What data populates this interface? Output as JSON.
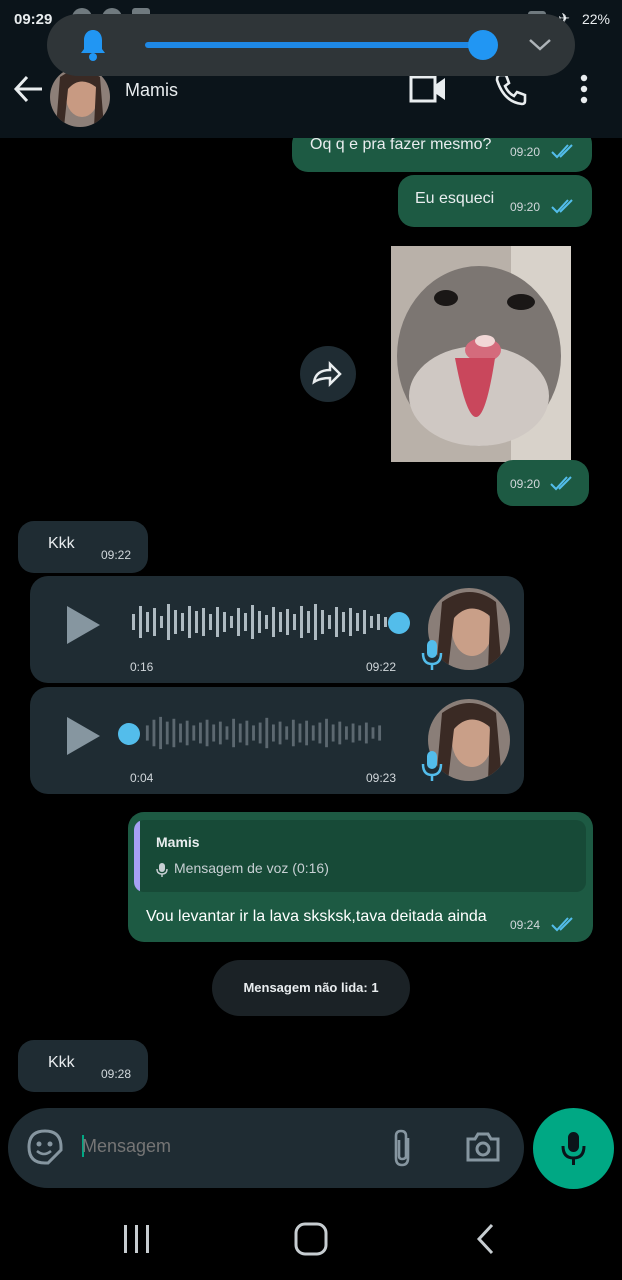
{
  "status": {
    "time": "09:29",
    "battery": "22%"
  },
  "volume": {
    "level": 1.0
  },
  "header": {
    "contact_name": "Mamis"
  },
  "messages": [
    {
      "dir": "out",
      "text": "Oq q e pra fazer mesmo?",
      "time": "09:20",
      "read": true
    },
    {
      "dir": "out",
      "text": "Eu esqueci",
      "time": "09:20",
      "read": true
    },
    {
      "dir": "out",
      "type": "image",
      "time": "09:20",
      "read": true
    },
    {
      "dir": "in",
      "text": "Kkk",
      "time": "09:22"
    },
    {
      "dir": "in",
      "type": "voice",
      "duration": "0:16",
      "time": "09:22"
    },
    {
      "dir": "in",
      "type": "voice",
      "duration": "0:04",
      "time": "09:23"
    },
    {
      "dir": "out",
      "reply_author": "Mamis",
      "reply_snippet": "Mensagem de voz (0:16)",
      "text": "Vou levantar ir la lava sksksk,tava deitada ainda",
      "time": "09:24",
      "read": true
    },
    {
      "dir": "in",
      "text": "Kkk",
      "time": "09:28"
    }
  ],
  "unread_label": "Mensagem não lida: 1",
  "composer": {
    "placeholder": "Mensagem"
  },
  "colors": {
    "accent": "#00a884",
    "outgoing": "#1d5a43",
    "incoming": "#1f2c33",
    "read_ticks": "#53bdeb"
  }
}
